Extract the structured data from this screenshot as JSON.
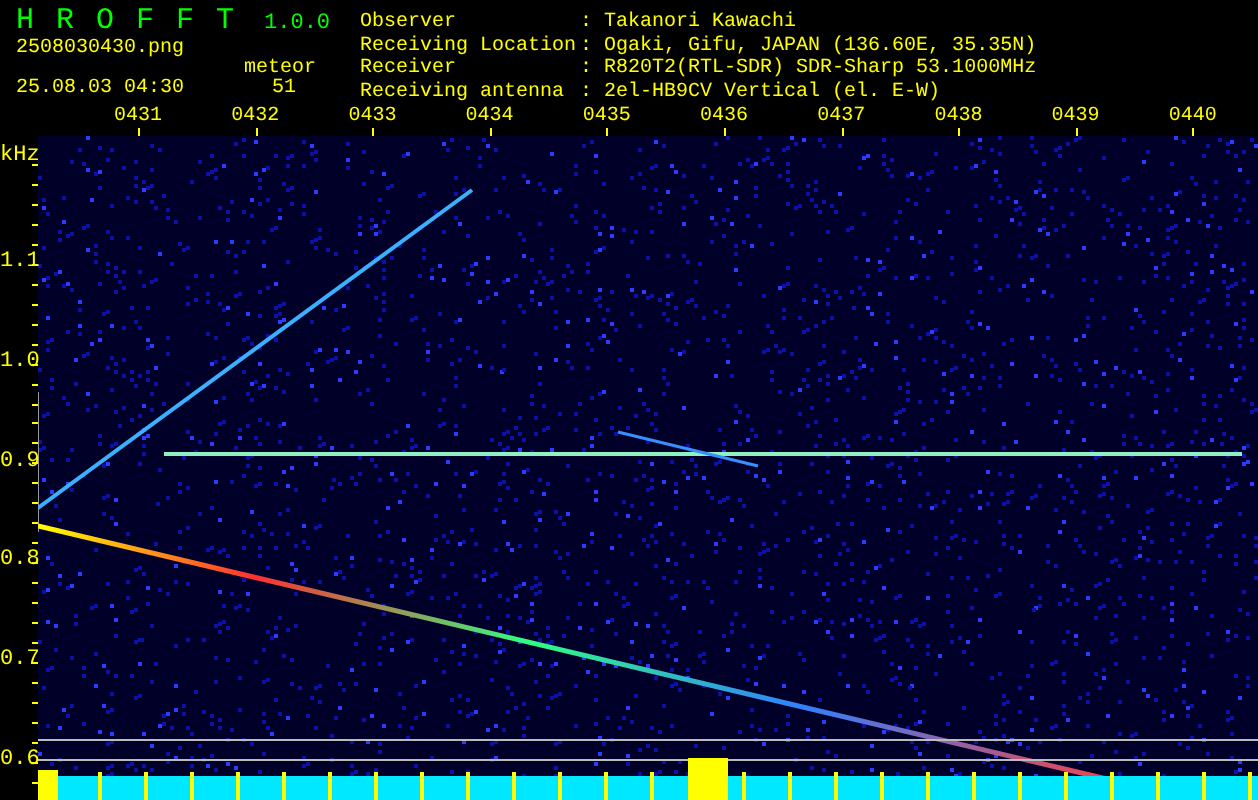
{
  "app": {
    "name": "HROFFT",
    "version": "1.0.0"
  },
  "file": "2508030430.png",
  "datetime": "25.08.03 04:30",
  "count_label": "meteor",
  "count": "51",
  "info": [
    {
      "label": "Observer",
      "value": ": Takanori Kawachi"
    },
    {
      "label": "Receiving Location",
      "value": ": Ogaki, Gifu, JAPAN (136.60E, 35.35N)"
    },
    {
      "label": "Receiver",
      "value": ": R820T2(RTL-SDR) SDR-Sharp 53.1000MHz"
    },
    {
      "label": "Receiving antenna",
      "value": ": 2el-HB9CV Vertical (el. E-W)"
    }
  ],
  "x_labels": [
    "0431",
    "0432",
    "0433",
    "0434",
    "0435",
    "0436",
    "0437",
    "0438",
    "0439",
    "0440"
  ],
  "y_unit": "kHz",
  "y_labels": [
    "1.1",
    "1.0",
    "0.9",
    "0.8",
    "0.7",
    "0.6"
  ]
}
